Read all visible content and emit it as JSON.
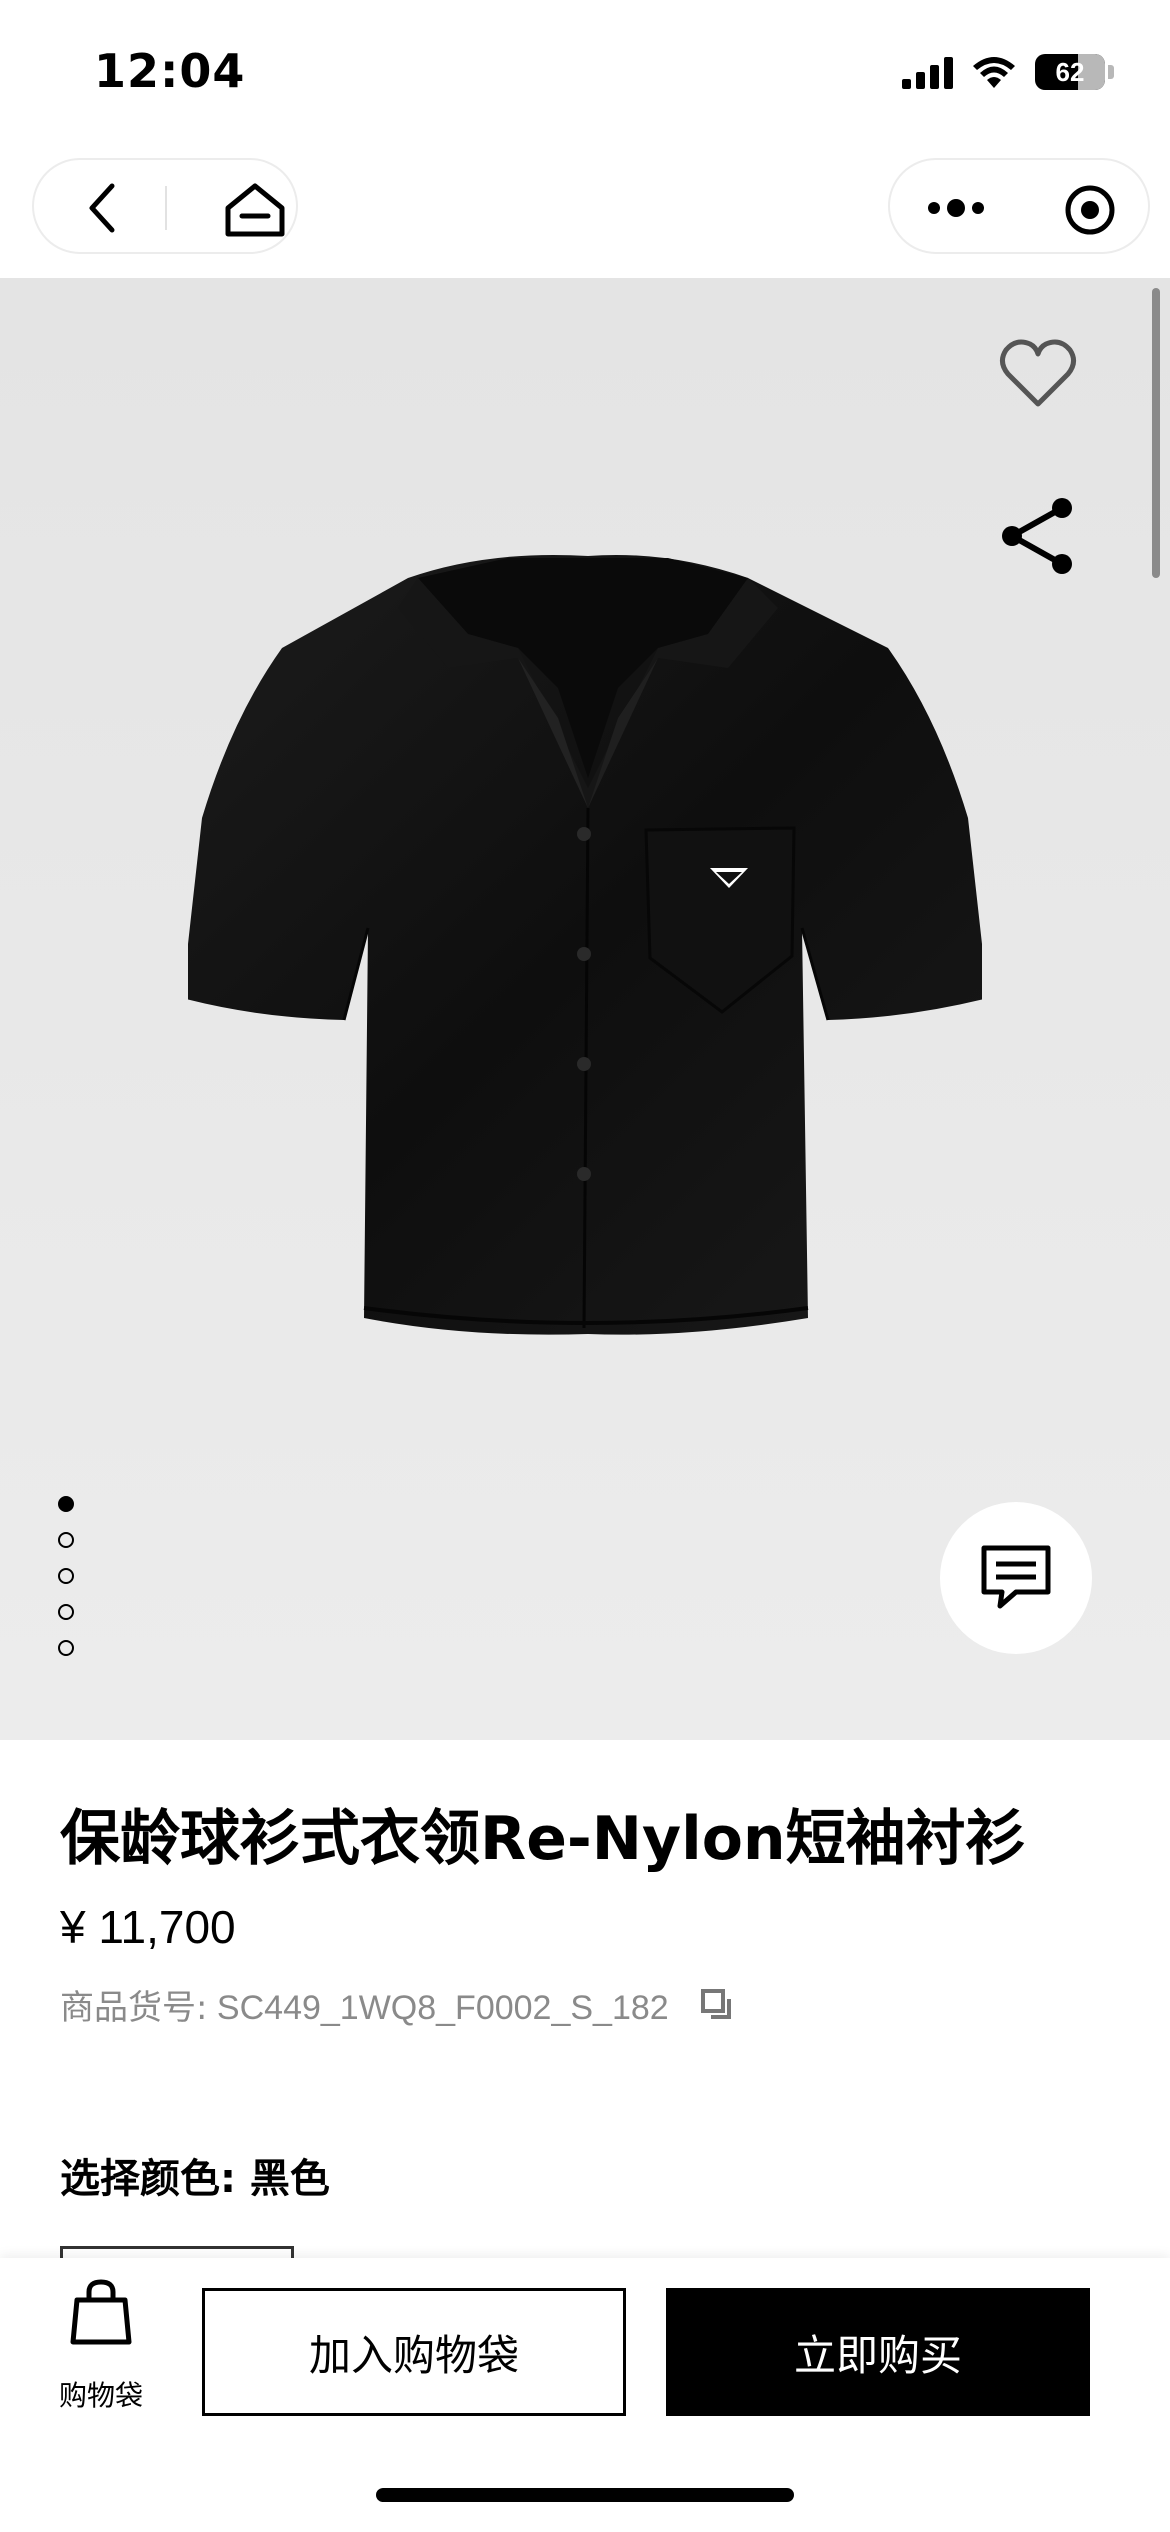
{
  "status_bar": {
    "time": "12:04",
    "battery": "62"
  },
  "product": {
    "title": "保龄球衫式衣领Re-Nylon短袖衬衫",
    "price": "¥ 11,700",
    "sku_label": "商品货号:",
    "sku_value": "SC449_1WQ8_F0002_S_182",
    "color_label": "选择颜色: 黑色",
    "image_count": 5,
    "active_image_index": 0,
    "shirt_color": "#141414"
  },
  "bottom_bar": {
    "bag_label": "购物袋",
    "add_to_bag": "加入购物袋",
    "buy_now": "立即购买"
  },
  "icons": [
    "back-icon",
    "home-icon",
    "more-icon",
    "target-icon",
    "heart-icon",
    "share-icon",
    "chat-icon",
    "copy-icon",
    "shopping-bag-icon"
  ]
}
